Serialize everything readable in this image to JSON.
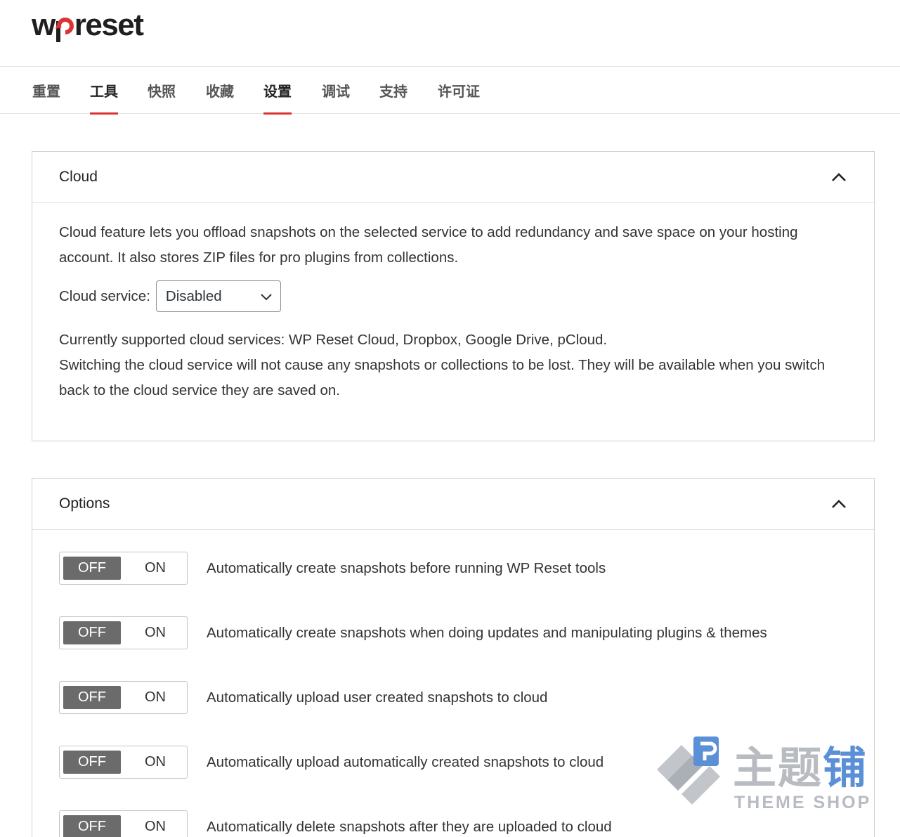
{
  "logo": {
    "text_before": "w",
    "text_after": "reset",
    "brand_red": "#dd3333"
  },
  "tabs": [
    {
      "label": "重置",
      "active": false
    },
    {
      "label": "工具",
      "active": true
    },
    {
      "label": "快照",
      "active": false
    },
    {
      "label": "收藏",
      "active": false
    },
    {
      "label": "设置",
      "active": true
    },
    {
      "label": "调试",
      "active": false
    },
    {
      "label": "支持",
      "active": false
    },
    {
      "label": "许可证",
      "active": false
    }
  ],
  "cloud": {
    "title": "Cloud",
    "intro": "Cloud feature lets you offload snapshots on the selected service to add redundancy and save space on your hosting account. It also stores ZIP files for pro plugins from collections.",
    "service_label": "Cloud service:",
    "service_value": "Disabled",
    "supported": "Currently supported cloud services: WP Reset Cloud, Dropbox, Google Drive, pCloud.",
    "switching_note": "Switching the cloud service will not cause any snapshots or collections to be lost. They will be available when you switch back to the cloud service they are saved on."
  },
  "options": {
    "title": "Options",
    "toggle_off": "OFF",
    "toggle_on": "ON",
    "items": [
      {
        "label": "Automatically create snapshots before running WP Reset tools",
        "state": "OFF"
      },
      {
        "label": "Automatically create snapshots when doing updates and manipulating plugins & themes",
        "state": "OFF"
      },
      {
        "label": "Automatically upload user created snapshots to cloud",
        "state": "OFF"
      },
      {
        "label": "Automatically upload automatically created snapshots to cloud",
        "state": "OFF"
      },
      {
        "label": "Automatically delete snapshots after they are uploaded to cloud",
        "state": "OFF"
      }
    ]
  },
  "watermark": {
    "title_gray": "主题",
    "title_blue": "铺",
    "subtitle": "THEME SHOP"
  }
}
